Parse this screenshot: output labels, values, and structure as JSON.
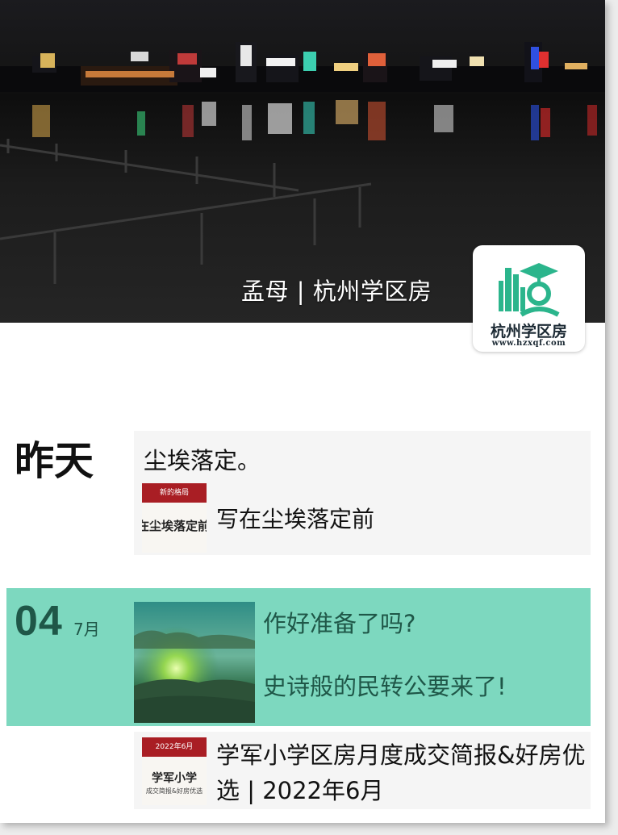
{
  "cover": {
    "caption": "孟母 | 杭州学区房"
  },
  "avatar": {
    "icon": "building-graduation-cap-logo",
    "name": "杭州学区房",
    "url": "www.hzxqf.com"
  },
  "feed": {
    "groups": [
      {
        "day_label": "昨天",
        "posts": [
          {
            "title": "尘埃落定。",
            "link": {
              "thumb_header": "新的格局",
              "thumb_text": "在尘埃落定前",
              "title": "写在尘埃落定前"
            }
          }
        ]
      },
      {
        "day": "04",
        "month": "7月",
        "posts": [
          {
            "title": "作好准备了吗?",
            "subtitle": "史诗般的民转公要来了!",
            "photo": "sunrise-over-mountains"
          },
          {
            "link": {
              "thumb_header": "2022年6月",
              "thumb_title": "学军小学",
              "thumb_sub": "成交简报&好房优选",
              "title": "学军小学区房月度成交简报&好房优选 | 2022年6月"
            }
          }
        ]
      }
    ]
  },
  "colors": {
    "highlight": "#7dd8bf",
    "highlight_text": "#1f5748",
    "card_background": "#f5f5f5",
    "thumb_red": "#a91e24",
    "logo_green": "#2bb58c"
  }
}
